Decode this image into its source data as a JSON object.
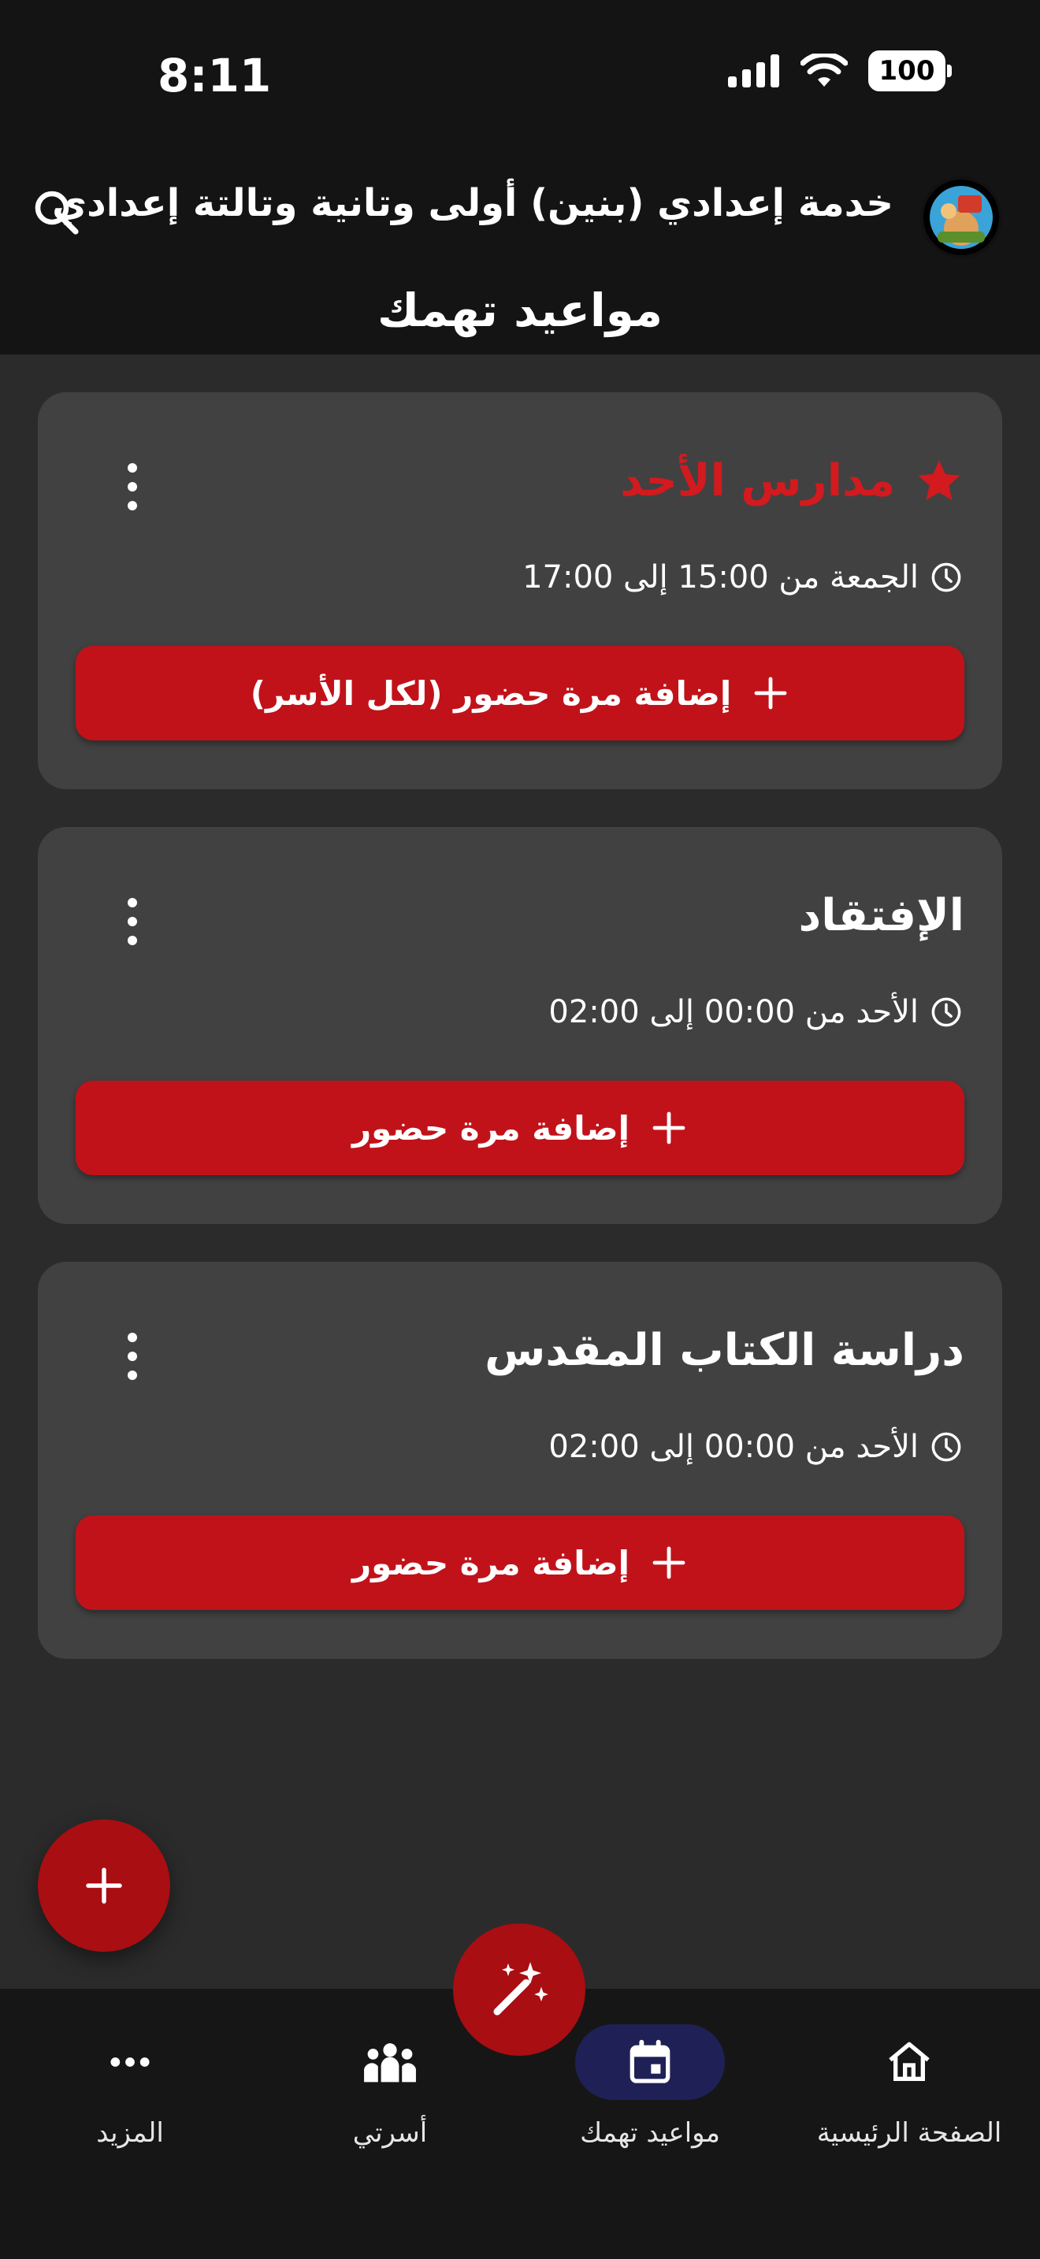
{
  "status": {
    "time": "8:11",
    "battery": "100"
  },
  "header": {
    "title": "خدمة إعدادي (بنين) أولى وتانية وتالتة إعدادي",
    "subtitle": "مواعيد تهمك"
  },
  "cards": [
    {
      "title": "مدارس الأحد",
      "favorite": true,
      "time": "الجمعة من 15:00 إلى 17:00",
      "action": "إضافة مرة حضور (لكل الأسر)"
    },
    {
      "title": "الإفتقاد",
      "favorite": false,
      "time": "الأحد من 00:00 إلى 02:00",
      "action": "إضافة مرة حضور"
    },
    {
      "title": "دراسة الكتاب المقدس",
      "favorite": false,
      "time": "الأحد من 00:00 إلى 02:00",
      "action": "إضافة مرة حضور"
    }
  ],
  "nav": {
    "home": "الصفحة الرئيسية",
    "schedules": "مواعيد تهمك",
    "family": "أسرتي",
    "more": "المزيد",
    "active": "schedules"
  },
  "colors": {
    "accent": "#c1121a",
    "fab": "#a80e12",
    "card_bg": "#414141",
    "active_nav": "#1f2156"
  }
}
